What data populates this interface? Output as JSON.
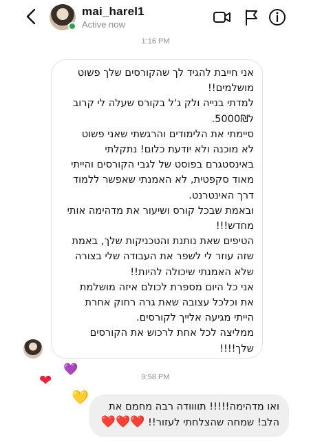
{
  "header": {
    "username": "mai_harel1",
    "status": "Active now",
    "icons": [
      "back-chevron-icon",
      "video-call-icon",
      "flag-icon",
      "info-icon"
    ]
  },
  "thread": {
    "timestamp_1": "1:16 PM",
    "received_message": "אני חייבת להגיד לך שהקורסים שלך פשוט\nמושלמים!!\nלמדתי בנייה ולק ג'ל בקורס שעלה לי קרוב\nל5000₪.\nסיימתי את הלימודים והרגשתי שאני פשוט\nלא מוכנה ולא יודעת כלום! נתקלתי\nבאינסטגרם בפוסט של לגבי הקורסים והייתי\nמאוד סקפטית, לא האמנתי שאפשר ללמוד\nדרך האינטרנט.\nובאמת שבכל קורס ושיעור את מדהימה אותי\nמחדש!!!\nהטיפים שאת נותנת והטכניקות שלך, באמת\nשזה עוזר לי לשפר את העבודה שלי בצורה\nשלא האמנתי שיכולה להיות!!\nאני כל היום מספרת לכולם איזה מושלמת\nאת וכלכל עצובה שאת גרה רחוק אחרת\nהייתי מגיעה אלייך לקורסים.\nממליצה לכל אחת לרכוש את הקורסים\nשלך!!!!",
    "timestamp_2": "9:58 PM",
    "reactions": [
      "❤",
      "💜",
      "💛"
    ],
    "sent_message": "ואו מדהימה!!!!! תוווודה רבה מחמם את\nהלב! שמחה שהצלחתי לעזור!! ",
    "sent_hearts": "❤️❤️❤️"
  },
  "colors": {
    "active": "#31a24c",
    "timestamp": "#8e8e8e",
    "sent_bubble": "#efefef",
    "heart": "#e5243b"
  }
}
